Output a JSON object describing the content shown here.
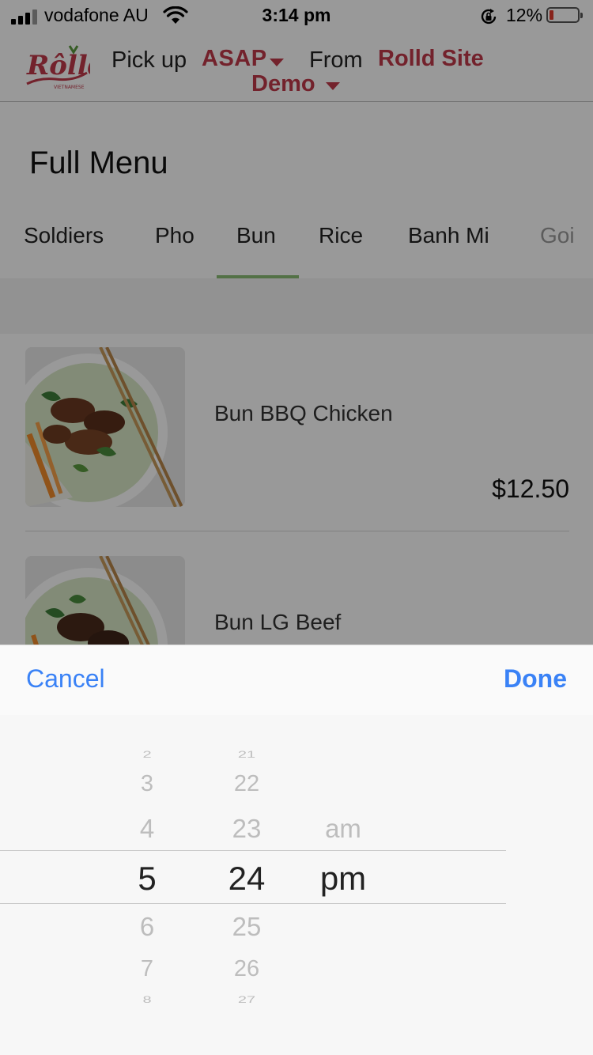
{
  "status_bar": {
    "carrier": "vodafone AU",
    "time": "3:14 pm",
    "battery": "12%"
  },
  "header": {
    "pickup_label": "Pick up",
    "pickup_time": "ASAP",
    "from_label": "From",
    "site_line1": "Rolld Site",
    "site_line2": "Demo",
    "brand_color": "#c0394a"
  },
  "page_title": "Full Menu",
  "tabs": [
    {
      "label": "Soldiers"
    },
    {
      "label": "Pho"
    },
    {
      "label": "Bun",
      "active": true
    },
    {
      "label": "Rice"
    },
    {
      "label": "Banh Mi"
    },
    {
      "label": "Goi"
    }
  ],
  "menu": {
    "items": [
      {
        "name": "Bun BBQ Chicken",
        "price": "$12.50"
      },
      {
        "name": "Bun LG Beef",
        "price": ""
      }
    ]
  },
  "picker": {
    "cancel_label": "Cancel",
    "done_label": "Done",
    "accent_color": "#3a82f6",
    "hours": [
      "2",
      "3",
      "4",
      "5",
      "6",
      "7",
      "8"
    ],
    "minutes": [
      "21",
      "22",
      "23",
      "24",
      "25",
      "26",
      "27"
    ],
    "meridiem": [
      "am",
      "pm"
    ],
    "selected": {
      "hour": "5",
      "minute": "24",
      "meridiem": "pm"
    }
  }
}
